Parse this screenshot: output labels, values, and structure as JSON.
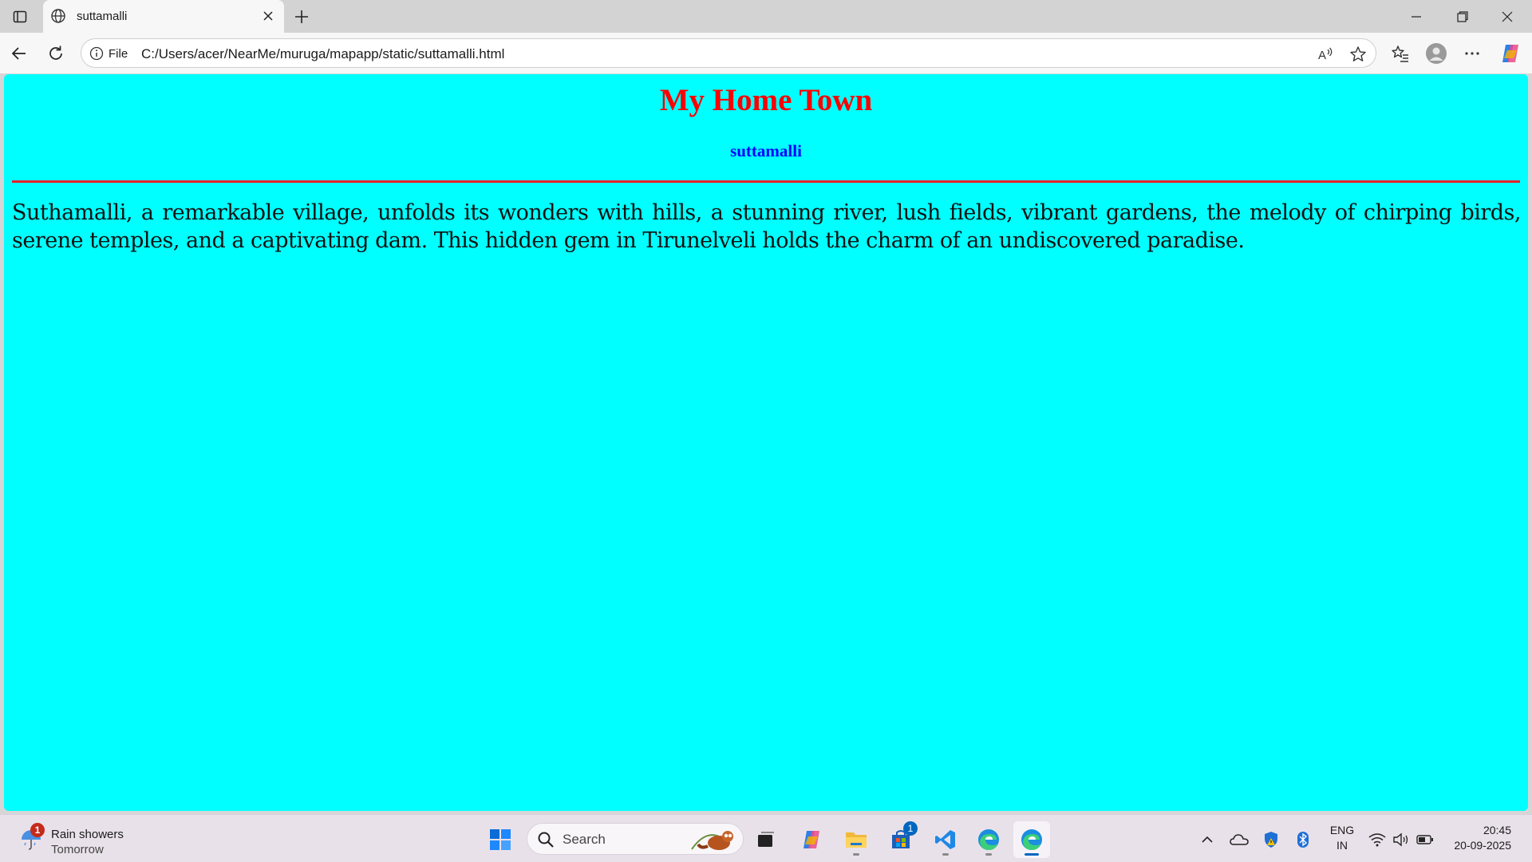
{
  "browser": {
    "tab_title": "suttamalli",
    "address": {
      "scheme_label": "File",
      "url": "C:/Users/acer/NearMe/muruga/mapapp/static/suttamalli.html"
    }
  },
  "page": {
    "background_color": "#00ffff",
    "heading": "My Home Town",
    "subheading": "suttamalli",
    "paragraph": "Suthamalli, a remarkable village, unfolds its wonders with hills, a stunning river, lush fields, vibrant gardens, the melody of chirping birds, serene temples, and a captivating dam. This hidden gem in Tirunelveli holds the charm of an undiscovered paradise."
  },
  "taskbar": {
    "weather": {
      "badge": "1",
      "condition": "Rain showers",
      "when": "Tomorrow"
    },
    "search_placeholder": "Search",
    "store_badge": "1",
    "language": {
      "line1": "ENG",
      "line2": "IN"
    },
    "clock": {
      "time": "20:45",
      "date": "20-09-2025"
    }
  }
}
